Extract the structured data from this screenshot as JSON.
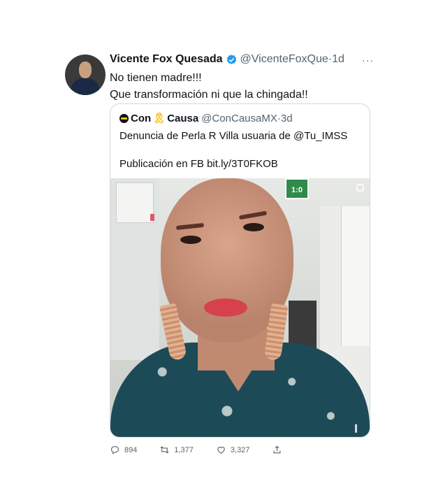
{
  "tweet": {
    "author_name": "Vicente Fox Quesada",
    "author_handle": "@VicenteFoxQue",
    "separator": "·",
    "time": "1d",
    "more": "···",
    "text_line1": "No tienen madre!!!",
    "text_line2": "Que transformación ni que la chingada!!"
  },
  "quote": {
    "name_part1": "Con",
    "ribbon": "🎗",
    "name_part2": "Causa",
    "handle": "@ConCausaMX",
    "separator": "·",
    "time": "3d",
    "text_line1": "Denuncia de Perla R Villa usuaria de @Tu_IMSS",
    "text_line2": "Publicación en FB bit.ly/3T0FKOB",
    "media_sign": "1:0"
  },
  "actions": {
    "replies": "894",
    "retweets": "1,377",
    "likes": "3,327"
  },
  "colors": {
    "verified": "#1d9bf0",
    "secondary_text": "#536471",
    "border": "#cfd9de"
  },
  "icons": [
    "verified-badge-icon",
    "more-icon",
    "reply-icon",
    "retweet-icon",
    "like-icon",
    "share-icon"
  ]
}
